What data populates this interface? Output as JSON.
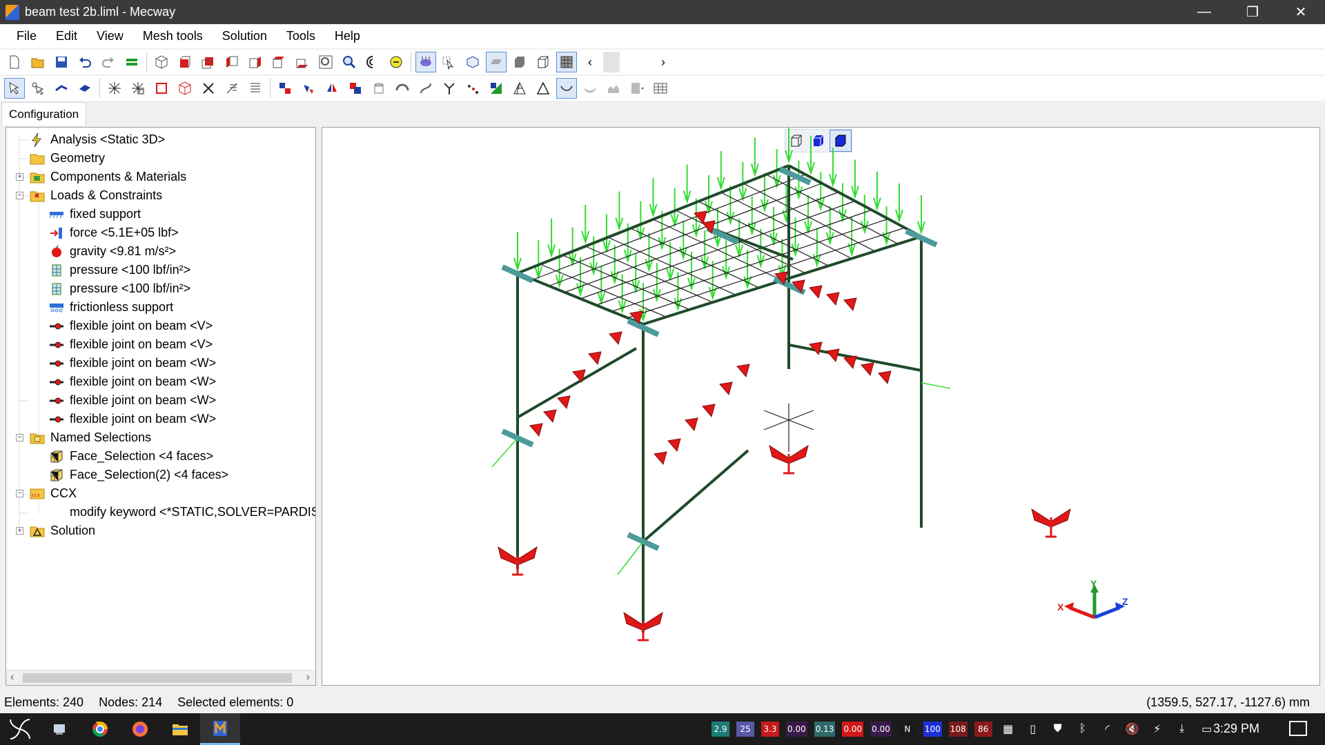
{
  "window": {
    "title": "beam test 2b.liml - Mecway",
    "controls": {
      "minimize": "—",
      "maximize": "❐",
      "close": "✕"
    }
  },
  "menu": [
    "File",
    "Edit",
    "View",
    "Mesh tools",
    "Solution",
    "Tools",
    "Help"
  ],
  "tabs": {
    "configuration": "Configuration"
  },
  "tree": {
    "analysis": "Analysis <Static 3D>",
    "geometry": "Geometry",
    "components": "Components & Materials",
    "loads": "Loads & Constraints",
    "load_items": [
      {
        "label": "fixed support",
        "icon": "fixed-support-icon"
      },
      {
        "label": "force <5.1E+05 lbf>",
        "icon": "force-icon"
      },
      {
        "label": "gravity <9.81 m/s²>",
        "icon": "gravity-icon"
      },
      {
        "label": "pressure <100 lbf/in²>",
        "icon": "pressure-icon"
      },
      {
        "label": "pressure <100 lbf/in²>",
        "icon": "pressure-icon"
      },
      {
        "label": "frictionless support",
        "icon": "frictionless-support-icon"
      },
      {
        "label": "flexible joint on beam <V>",
        "icon": "flexible-joint-icon"
      },
      {
        "label": "flexible joint on beam <V>",
        "icon": "flexible-joint-icon"
      },
      {
        "label": "flexible joint on beam <W>",
        "icon": "flexible-joint-icon"
      },
      {
        "label": "flexible joint on beam <W>",
        "icon": "flexible-joint-icon"
      },
      {
        "label": "flexible joint on beam <W>",
        "icon": "flexible-joint-icon"
      },
      {
        "label": "flexible joint on beam <W>",
        "icon": "flexible-joint-icon"
      }
    ],
    "named_selections": "Named Selections",
    "selections": [
      "Face_Selection <4 faces>",
      "Face_Selection(2) <4 faces>"
    ],
    "ccx": "CCX",
    "ccx_keyword": "modify keyword <*STATIC,SOLVER=PARDISO>",
    "solution": "Solution"
  },
  "status": {
    "elements": "Elements: 240",
    "nodes": "Nodes: 214",
    "selected": "Selected elements: 0",
    "coords": "(1359.5, 527.17, -1127.6) mm"
  },
  "axes": {
    "x": "X",
    "y": "Y",
    "z": "Z"
  },
  "taskbar": {
    "tray_values": [
      {
        "v": "2.9",
        "c": "#1d7b76"
      },
      {
        "v": "25",
        "c": "#5a58a8"
      },
      {
        "v": "3.3",
        "c": "#c61a1a"
      },
      {
        "v": "0.00",
        "c": "#3a1a4a"
      },
      {
        "v": "0.13",
        "c": "#2f6a6a"
      },
      {
        "v": "0.00",
        "c": "#d01818"
      },
      {
        "v": "0.00",
        "c": "#3a1a4a"
      },
      {
        "v": "N",
        "c": "#1a1a1a"
      },
      {
        "v": "100",
        "c": "#1d2fd6"
      },
      {
        "v": "108",
        "c": "#7a1a1a"
      },
      {
        "v": "86",
        "c": "#8a1a1a"
      }
    ],
    "time": "3:29 PM"
  },
  "colors": {
    "beam": "#1f4a2a",
    "arrow": "#33dd33",
    "pressure": "#e01818",
    "joint": "#4d9a9a",
    "grid": "#1e1e1e"
  }
}
